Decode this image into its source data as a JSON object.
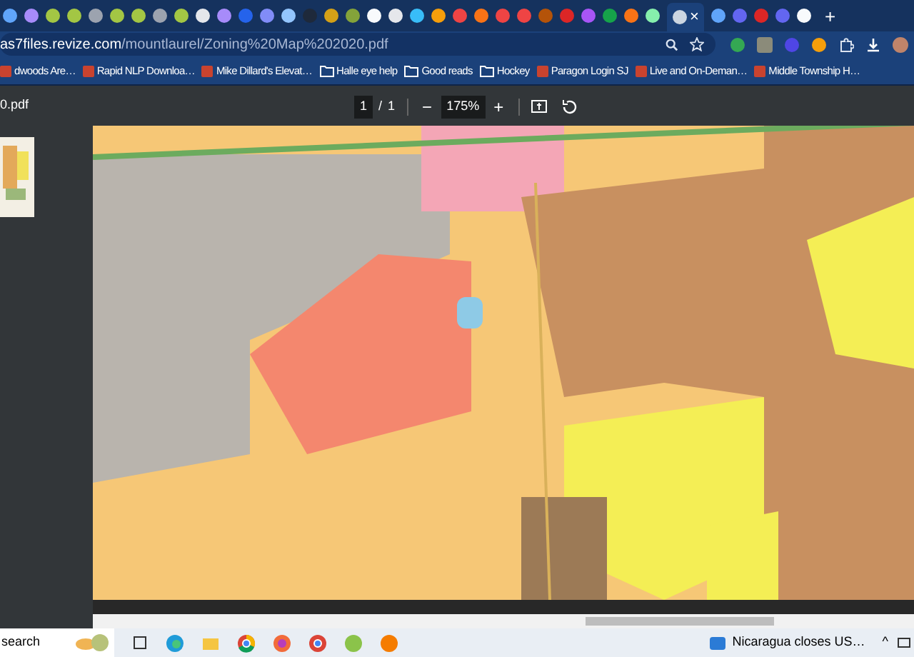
{
  "tabs": [
    {
      "color": "#60a5fa",
      "selected": false
    },
    {
      "color": "#a78bfa",
      "selected": false
    },
    {
      "color": "#a3c644",
      "selected": false
    },
    {
      "color": "#a3c644",
      "selected": false
    },
    {
      "color": "#9ca3af",
      "selected": false
    },
    {
      "color": "#a3c644",
      "selected": false
    },
    {
      "color": "#a3c644",
      "selected": false
    },
    {
      "color": "#9ca3af",
      "selected": false
    },
    {
      "color": "#a3c644",
      "selected": false
    },
    {
      "color": "#e5e7eb",
      "selected": false
    },
    {
      "color": "#a78bfa",
      "selected": false
    },
    {
      "color": "#2563eb",
      "selected": false
    },
    {
      "color": "#818cf8",
      "selected": false
    },
    {
      "color": "#93c5fd",
      "selected": false
    },
    {
      "color": "#1e293b",
      "selected": false
    },
    {
      "color": "#d4a017",
      "selected": false
    },
    {
      "color": "#84a33a",
      "selected": false
    },
    {
      "color": "#f8fafc",
      "selected": false
    },
    {
      "color": "#e5e7eb",
      "selected": false
    },
    {
      "color": "#38bdf8",
      "selected": false
    },
    {
      "color": "#f59e0b",
      "selected": false
    },
    {
      "color": "#ef4444",
      "selected": false
    },
    {
      "color": "#f97316",
      "selected": false
    },
    {
      "color": "#ef4444",
      "selected": false
    },
    {
      "color": "#ef4444",
      "selected": false
    },
    {
      "color": "#b45309",
      "selected": false
    },
    {
      "color": "#dc2626",
      "selected": false
    },
    {
      "color": "#a855f7",
      "selected": false
    },
    {
      "color": "#16a34a",
      "selected": false
    },
    {
      "color": "#f97316",
      "selected": false
    },
    {
      "color": "#86efac",
      "selected": false
    },
    {
      "color": "#cbd5e1",
      "selected": true
    },
    {
      "color": "#60a5fa",
      "selected": false
    },
    {
      "color": "#6366f1",
      "selected": false
    },
    {
      "color": "#dc2626",
      "selected": false
    },
    {
      "color": "#6366f1",
      "selected": false
    },
    {
      "color": "#f8fafc",
      "selected": false
    }
  ],
  "tab_close": "×",
  "new_tab": "+",
  "address_bar": {
    "host": "as7files.revize.com",
    "path": "/mountlaurel/Zoning%20Map%202020.pdf"
  },
  "bookmarks": [
    {
      "kind": "site",
      "label": "dwoods Are…"
    },
    {
      "kind": "site",
      "label": "Rapid NLP Downloa…"
    },
    {
      "kind": "site",
      "label": "Mike Dillard's Elevat…"
    },
    {
      "kind": "folder",
      "label": "Halle eye help"
    },
    {
      "kind": "folder",
      "label": "Good reads"
    },
    {
      "kind": "folder",
      "label": "Hockey"
    },
    {
      "kind": "site",
      "label": "Paragon Login SJ"
    },
    {
      "kind": "site",
      "label": "Live and On-Deman…"
    },
    {
      "kind": "site",
      "label": "Middle Township H…"
    }
  ],
  "pdf_toolbar": {
    "title": "0.pdf",
    "page": "1",
    "separator": "/",
    "page_count": "1",
    "zoom_out": "−",
    "zoom": "175%",
    "zoom_in": "+"
  },
  "taskbar": {
    "search": "search",
    "news": "Nicaragua closes US…",
    "chevron": "^"
  }
}
